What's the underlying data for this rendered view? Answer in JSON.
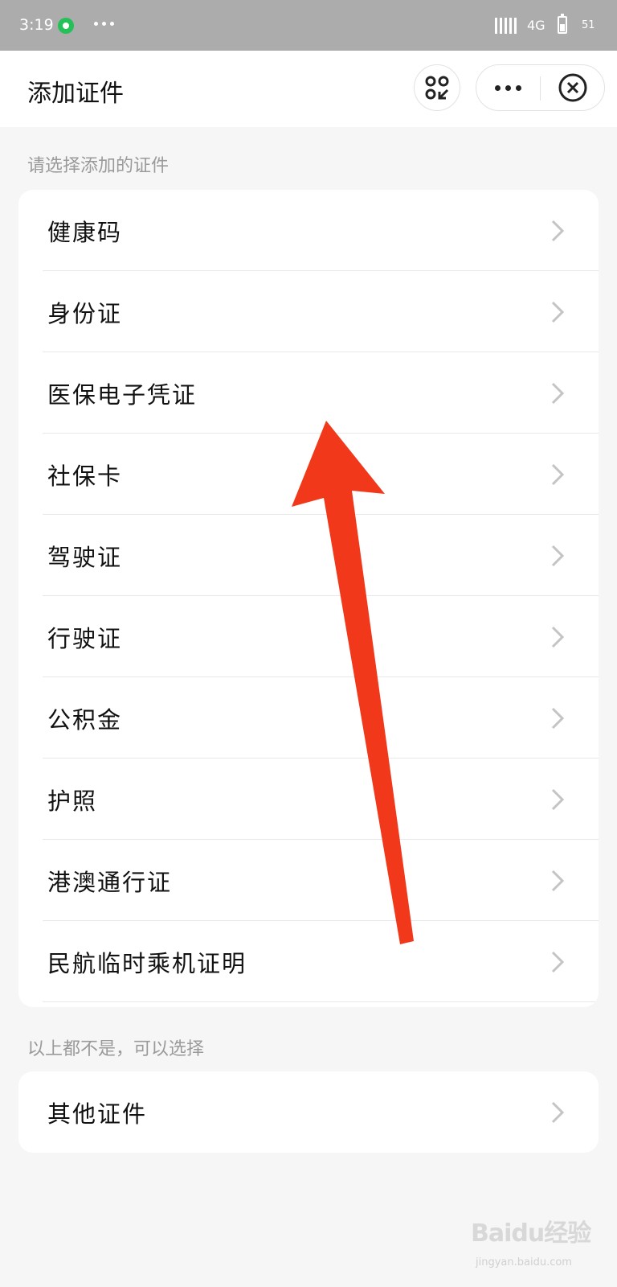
{
  "status_bar": {
    "time": "3:19",
    "network": "4G",
    "level": "51"
  },
  "nav": {
    "title": "添加证件"
  },
  "sections": {
    "choose_header": "请选择添加的证件",
    "other_header": "以上都不是，可以选择"
  },
  "documents": [
    {
      "label": "健康码"
    },
    {
      "label": "身份证"
    },
    {
      "label": "医保电子凭证"
    },
    {
      "label": "社保卡"
    },
    {
      "label": "驾驶证"
    },
    {
      "label": "行驶证"
    },
    {
      "label": "公积金"
    },
    {
      "label": "护照"
    },
    {
      "label": "港澳通行证"
    },
    {
      "label": "民航临时乘机证明"
    }
  ],
  "other": {
    "label": "其他证件"
  },
  "watermark": {
    "text": "Baidu经验",
    "sub": "jingyan.baidu.com"
  },
  "colors": {
    "annotation_arrow": "#f2381a",
    "status_bar_bg": "#acacac",
    "page_bg": "#f6f6f6"
  }
}
